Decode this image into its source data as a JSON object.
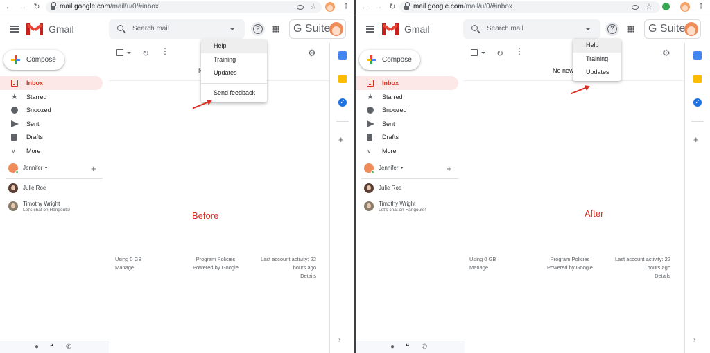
{
  "browser": {
    "url_host": "mail.google.com",
    "url_path": "/mail/u/0/#inbox"
  },
  "app": {
    "name": "Gmail",
    "gsuite_label": "G Suite"
  },
  "search": {
    "placeholder": "Search mail"
  },
  "compose_label": "Compose",
  "nav": [
    {
      "label": "Inbox",
      "icon": "inbox-icon",
      "active": true
    },
    {
      "label": "Starred",
      "icon": "star-icon"
    },
    {
      "label": "Snoozed",
      "icon": "clock-icon"
    },
    {
      "label": "Sent",
      "icon": "send-icon"
    },
    {
      "label": "Drafts",
      "icon": "drafts-icon"
    },
    {
      "label": "More",
      "icon": "chevron-down-icon"
    }
  ],
  "hangouts": {
    "self_name": "Jennifer",
    "contacts": [
      {
        "name": "Julie Roe",
        "status": ""
      },
      {
        "name": "Timothy Wright",
        "status": "Let's chat on Hangouts!"
      }
    ]
  },
  "mail": {
    "empty_left": "N",
    "empty_right": "No new"
  },
  "footer": {
    "storage_line1": "Using 0 GB",
    "storage_line2": "Manage",
    "policy_line1": "Program Policies",
    "policy_line2": "Powered by Google",
    "activity_line1": "Last account activity: 22",
    "activity_line2": "hours ago",
    "activity_line3": "Details"
  },
  "help_menu_before": [
    "Help",
    "Training",
    "Updates",
    "Send feedback"
  ],
  "help_menu_after": [
    "Help",
    "Training",
    "Updates"
  ],
  "captions": {
    "before": "Before",
    "after": "After"
  },
  "colors": {
    "accent_red": "#d93025",
    "inbox_active_bg": "#fce8e6"
  }
}
